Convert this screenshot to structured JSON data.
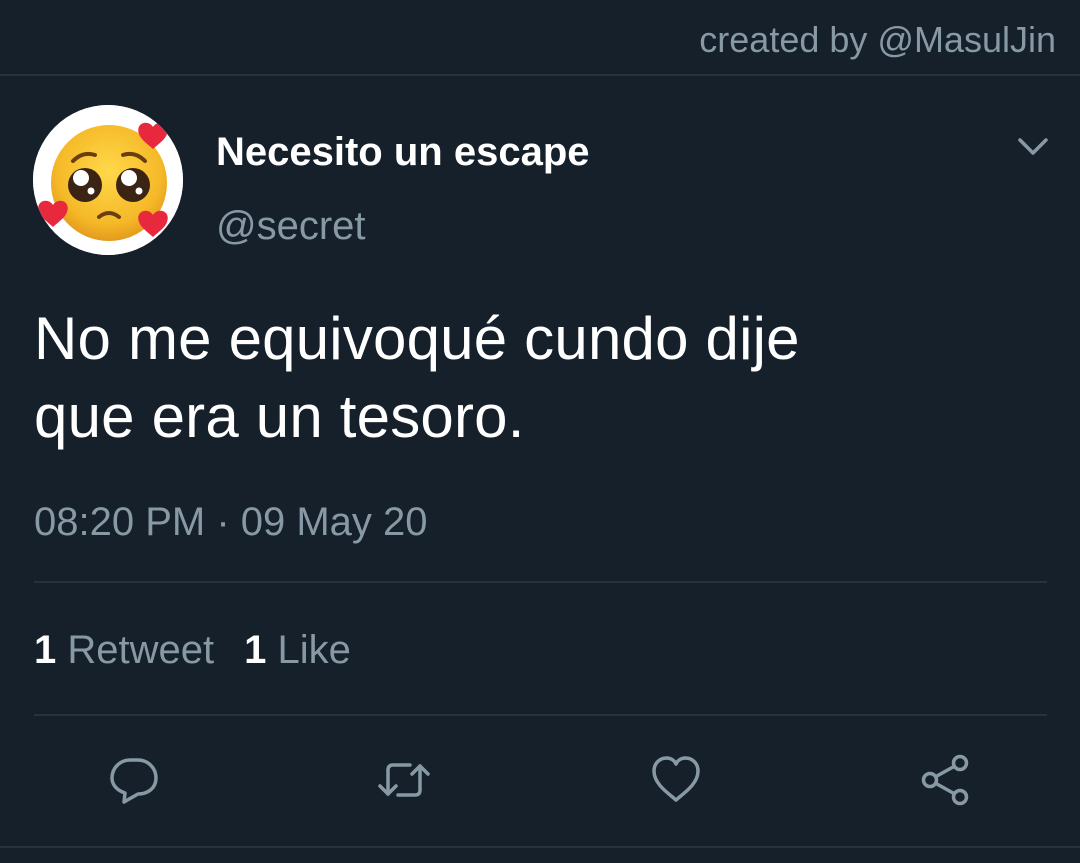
{
  "credit": "created by @MasulJin",
  "author": {
    "display_name": "Necesito un escape",
    "handle": "@secret",
    "avatar_icon": "pleading-face-with-hearts-emoji"
  },
  "tweet": {
    "text_line1": "No me equivoqué cundo dije",
    "text_line2": "que era un tesoro.",
    "timestamp": "08:20 PM · 09 May 20"
  },
  "stats": {
    "retweets_count": "1",
    "retweets_label": "Retweet",
    "likes_count": "1",
    "likes_label": "Like"
  },
  "actions": [
    "reply-icon",
    "retweet-icon",
    "like-icon",
    "share-icon"
  ],
  "colors": {
    "background": "#15202b",
    "secondary_text": "#8899a6",
    "divider": "#253341",
    "primary_text": "#ffffff"
  }
}
